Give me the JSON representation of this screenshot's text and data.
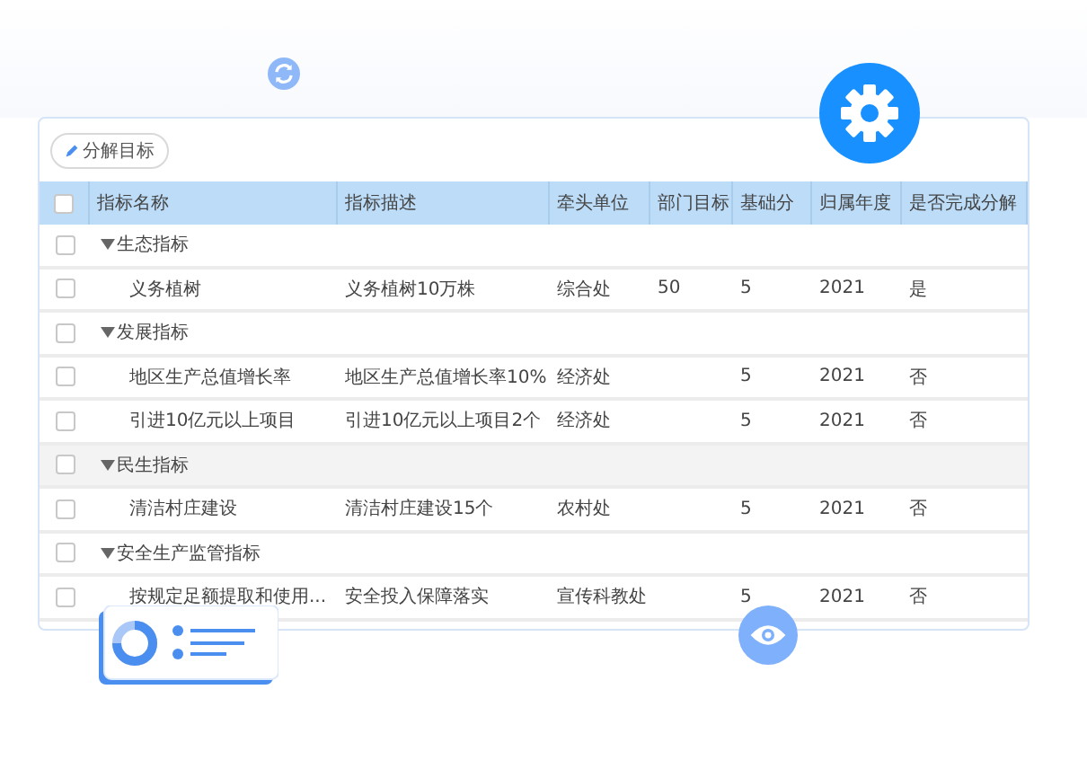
{
  "toolbar": {
    "button": "分解目标"
  },
  "table": {
    "header_checked": false,
    "columns": [
      "指标名称",
      "指标描述",
      "牵头单位",
      "部门目标",
      "基础分",
      "归属年度",
      "是否完成分解"
    ],
    "groups": [
      {
        "name": "生态指标",
        "expanded": true,
        "checked": false,
        "highlighted": false,
        "children": [
          {
            "name": "义务植树",
            "description": "义务植树10万株",
            "unit": "综合处",
            "dept_target": "50",
            "base_score": "5",
            "year": "2021",
            "completed": "是",
            "checked": false
          }
        ]
      },
      {
        "name": "发展指标",
        "expanded": true,
        "checked": false,
        "highlighted": false,
        "children": [
          {
            "name": "地区生产总值增长率",
            "description": "地区生产总值增长率10%",
            "unit": "经济处",
            "base_score": "5",
            "year": "2021",
            "completed": "否",
            "checked": false
          },
          {
            "name": "引进10亿元以上项目",
            "description": "引进10亿元以上项目2个",
            "unit": "经济处",
            "base_score": "5",
            "year": "2021",
            "completed": "否",
            "checked": false
          }
        ]
      },
      {
        "name": "民生指标",
        "expanded": true,
        "checked": false,
        "highlighted": true,
        "children": [
          {
            "name": "清洁村庄建设",
            "description": "清洁村庄建设15个",
            "unit": "农村处",
            "base_score": "5",
            "year": "2021",
            "completed": "否",
            "checked": false
          }
        ]
      },
      {
        "name": "安全生产监管指标",
        "expanded": true,
        "checked": false,
        "highlighted": false,
        "children": [
          {
            "name": "按规定足额提取和使用...",
            "description": "安全投入保障落实",
            "unit": "宣传科教处",
            "base_score": "5",
            "year": "2021",
            "completed": "否",
            "checked": false
          }
        ]
      }
    ]
  }
}
